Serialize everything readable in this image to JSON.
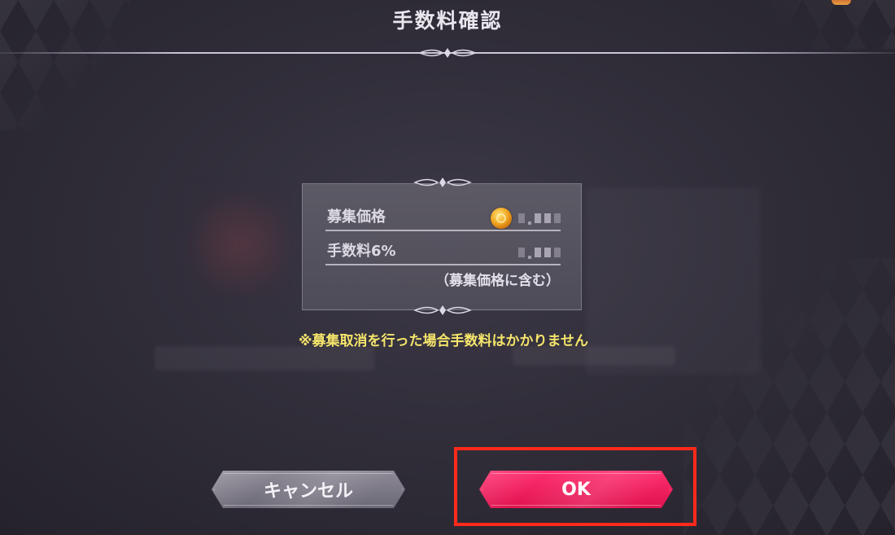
{
  "dialog": {
    "title": "手数料確認"
  },
  "fee_box": {
    "price_label": "募集価格",
    "price_value_icon": "coin-icon",
    "fee_label": "手数料6%",
    "fee_note": "（募集価格に含む）"
  },
  "warning_text": "※募集取消を行った場合手数料はかかりません",
  "buttons": {
    "cancel_label": "キャンセル",
    "ok_label": "OK"
  },
  "colors": {
    "ok_button": "#f0245f",
    "cancel_button": "#7c7986",
    "warning_text": "#f5e56b",
    "highlight_frame": "#ff2a1a"
  }
}
